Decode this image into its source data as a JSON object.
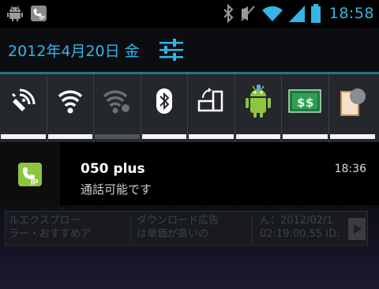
{
  "status_bar": {
    "left_icons": [
      "android-debug-icon",
      "ip-phone-app-icon"
    ],
    "right_icons": [
      "bluetooth-icon",
      "vibrate-mute-icon",
      "wifi-signal-icon",
      "cell-signal-icon",
      "battery-icon"
    ],
    "time": "18:58"
  },
  "header": {
    "date": "2012年4月20日 金",
    "settings_icon": "quick-settings-icon"
  },
  "toggles": [
    {
      "name": "gps",
      "icon": "gps-icon",
      "state": "on"
    },
    {
      "name": "wifi",
      "icon": "wifi-icon",
      "state": "on"
    },
    {
      "name": "wifi-hotspot",
      "icon": "wifi-hotspot-icon",
      "state": "off"
    },
    {
      "name": "bluetooth",
      "icon": "bluetooth-icon",
      "state": "on"
    },
    {
      "name": "auto-rotate",
      "icon": "rotate-icon",
      "state": "on"
    },
    {
      "name": "usb-debugging",
      "icon": "android-icon",
      "state": "on"
    },
    {
      "name": "money",
      "icon": "money-icon",
      "state": "on"
    },
    {
      "name": "other",
      "icon": "notepad-icon",
      "state": "on"
    }
  ],
  "notification": {
    "icon": "ip-phone-icon",
    "title": "050 plus",
    "text": "通話可能です",
    "time": "18:36"
  },
  "background_app": {
    "col1": [
      "ルエクスプロー",
      "ラー・おすすめア"
    ],
    "col2": [
      "ダウンロード広告",
      "は単価が高いの"
    ],
    "col3": [
      "ん：2012/02/1",
      "02:19:00.55 ID:"
    ]
  },
  "colors": {
    "accent": "#33b5e5",
    "toggle_on": "#f4f4f4",
    "toggle_off": "#4f535a",
    "ip_green": "#8cc63f"
  }
}
